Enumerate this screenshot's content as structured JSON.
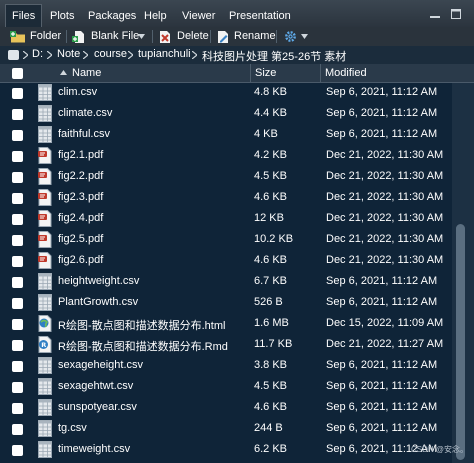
{
  "tabs": [
    {
      "label": "Files",
      "active": true
    },
    {
      "label": "Plots",
      "active": false
    },
    {
      "label": "Packages",
      "active": false
    },
    {
      "label": "Help",
      "active": false
    },
    {
      "label": "Viewer",
      "active": false
    },
    {
      "label": "Presentation",
      "active": false
    }
  ],
  "window_controls": {
    "minimize_icon": "minimize-icon",
    "maximize_icon": "maximize-icon"
  },
  "toolbar": {
    "new_folder": "Folder",
    "blank_file": "Blank File",
    "delete": "Delete",
    "rename": "Rename",
    "more_icon": "gear-icon"
  },
  "path": {
    "home_icon": "home-icon",
    "segments": [
      "D:",
      "Note",
      "course",
      "tupianchuli",
      "科技图片处理 第25-26节 素材"
    ],
    "separator": "›"
  },
  "table": {
    "headers": {
      "name": "Name",
      "sort_indicator": "▲",
      "size": "Size",
      "modified": "Modified"
    },
    "files": [
      {
        "name": "clim.csv",
        "type": "csv",
        "size": "4.8 KB",
        "modified": "Sep 6, 2021, 11:12 AM"
      },
      {
        "name": "climate.csv",
        "type": "csv",
        "size": "4.4 KB",
        "modified": "Sep 6, 2021, 11:12 AM"
      },
      {
        "name": "faithful.csv",
        "type": "csv",
        "size": "4 KB",
        "modified": "Sep 6, 2021, 11:12 AM"
      },
      {
        "name": "fig2.1.pdf",
        "type": "pdf",
        "size": "4.2 KB",
        "modified": "Dec 21, 2022, 11:30 AM"
      },
      {
        "name": "fig2.2.pdf",
        "type": "pdf",
        "size": "4.5 KB",
        "modified": "Dec 21, 2022, 11:30 AM"
      },
      {
        "name": "fig2.3.pdf",
        "type": "pdf",
        "size": "4.6 KB",
        "modified": "Dec 21, 2022, 11:30 AM"
      },
      {
        "name": "fig2.4.pdf",
        "type": "pdf",
        "size": "12 KB",
        "modified": "Dec 21, 2022, 11:30 AM"
      },
      {
        "name": "fig2.5.pdf",
        "type": "pdf",
        "size": "10.2 KB",
        "modified": "Dec 21, 2022, 11:30 AM"
      },
      {
        "name": "fig2.6.pdf",
        "type": "pdf",
        "size": "4.6 KB",
        "modified": "Dec 21, 2022, 11:30 AM"
      },
      {
        "name": "heightweight.csv",
        "type": "csv",
        "size": "6.7 KB",
        "modified": "Sep 6, 2021, 11:12 AM"
      },
      {
        "name": "PlantGrowth.csv",
        "type": "csv",
        "size": "526 B",
        "modified": "Sep 6, 2021, 11:12 AM"
      },
      {
        "name": "R绘图-散点图和描述数据分布.html",
        "type": "html",
        "size": "1.6 MB",
        "modified": "Dec 15, 2022, 11:09 AM"
      },
      {
        "name": "R绘图-散点图和描述数据分布.Rmd",
        "type": "rmd",
        "size": "11.7 KB",
        "modified": "Dec 21, 2022, 11:27 AM"
      },
      {
        "name": "sexageheight.csv",
        "type": "csv",
        "size": "3.8 KB",
        "modified": "Sep 6, 2021, 11:12 AM"
      },
      {
        "name": "sexagehtwt.csv",
        "type": "csv",
        "size": "4.5 KB",
        "modified": "Sep 6, 2021, 11:12 AM"
      },
      {
        "name": "sunspotyear.csv",
        "type": "csv",
        "size": "4.6 KB",
        "modified": "Sep 6, 2021, 11:12 AM"
      },
      {
        "name": "tg.csv",
        "type": "csv",
        "size": "244 B",
        "modified": "Sep 6, 2021, 11:12 AM"
      },
      {
        "name": "timeweight.csv",
        "type": "csv",
        "size": "6.2 KB",
        "modified": "Sep 6, 2021, 11:12 AM"
      }
    ]
  },
  "watermark": "CSDN @安念。",
  "colors": {
    "background": "#0f2438",
    "tabbar": "#2f3943",
    "pdf_red": "#c0392b",
    "csv_grey": "#d9dee3",
    "accent_green": "#2e9c4c"
  }
}
